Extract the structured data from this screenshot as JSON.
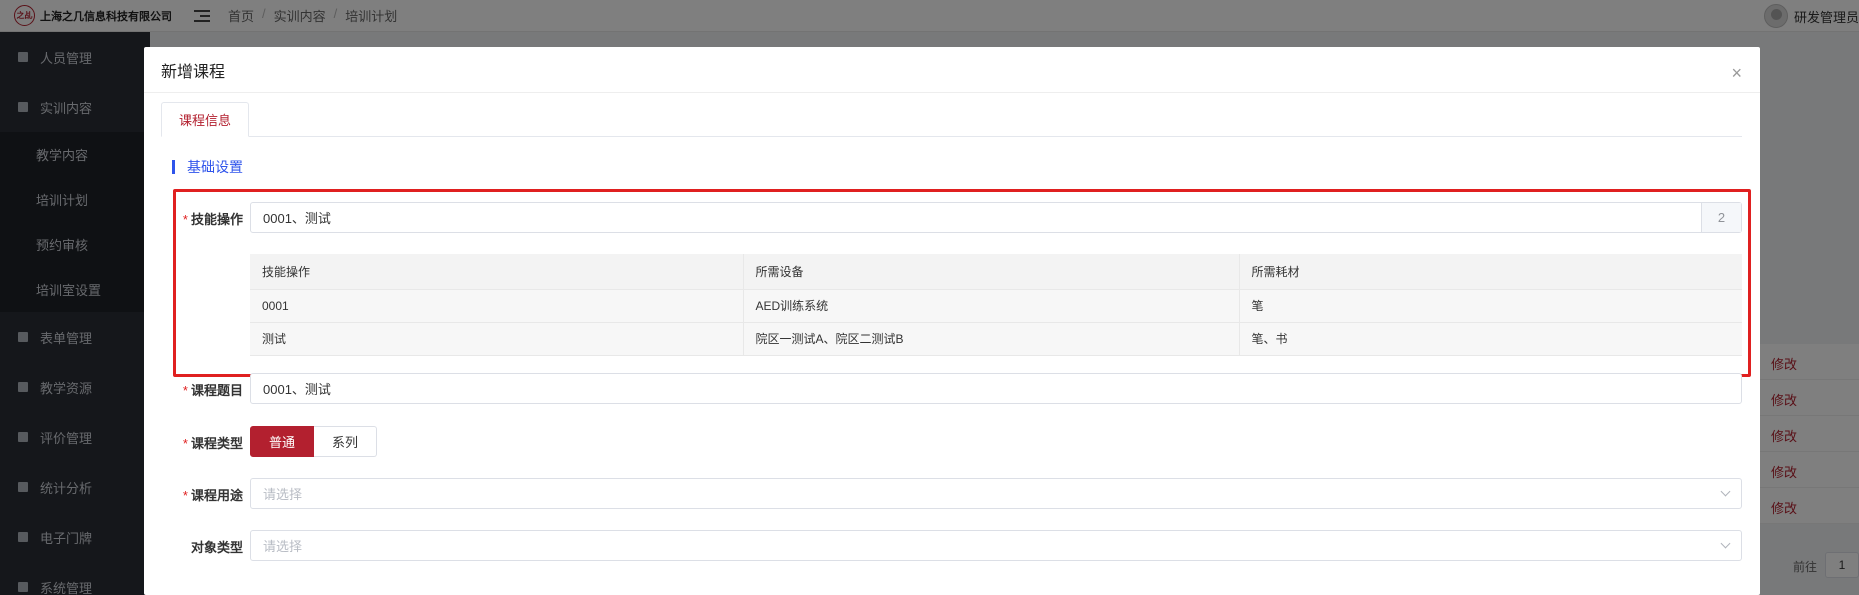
{
  "app": {
    "logo_mark": "之乩",
    "company": "上海之几信息科技有限公司",
    "user_name": "研发管理员"
  },
  "breadcrumb": [
    "首页",
    "实训内容",
    "培训计划"
  ],
  "sidebar": {
    "items": [
      {
        "label": "人员管理",
        "icon": "user-icon"
      },
      {
        "label": "实训内容",
        "icon": "book-icon"
      }
    ],
    "sub_items": [
      "教学内容",
      "培训计划",
      "预约审核",
      "培训室设置"
    ],
    "more_items": [
      {
        "label": "表单管理",
        "icon": "form-icon"
      },
      {
        "label": "教学资源",
        "icon": "resource-icon"
      },
      {
        "label": "评价管理",
        "icon": "evaluate-icon"
      },
      {
        "label": "统计分析",
        "icon": "chart-icon"
      },
      {
        "label": "电子门牌",
        "icon": "display-icon"
      },
      {
        "label": "系统管理",
        "icon": "gear-icon"
      }
    ]
  },
  "background": {
    "row_action": "修改",
    "pager_label": "前往",
    "pager_value": "1"
  },
  "dialog": {
    "title": "新增课程",
    "close_glyph": "×",
    "tab": "课程信息",
    "section": "基础设置",
    "skill": {
      "label": "技能操作",
      "value": "0001、测试",
      "count": "2"
    },
    "table": {
      "headers": [
        "技能操作",
        "所需设备",
        "所需耗材"
      ],
      "rows": [
        [
          "0001",
          "AED训练系统",
          "笔"
        ],
        [
          "测试",
          "院区一测试A、院区二测试B",
          "笔、书"
        ]
      ]
    },
    "course_title": {
      "label": "课程题目",
      "value": "0001、测试"
    },
    "course_type": {
      "label": "课程类型",
      "options": [
        "普通",
        "系列"
      ],
      "selected": "普通"
    },
    "course_use": {
      "label": "课程用途",
      "placeholder": "请选择"
    },
    "object_type": {
      "label": "对象类型",
      "placeholder": "请选择"
    }
  },
  "colors": {
    "brand": "#b3202f",
    "accent": "#2f54eb",
    "highlight": "#e02020"
  }
}
